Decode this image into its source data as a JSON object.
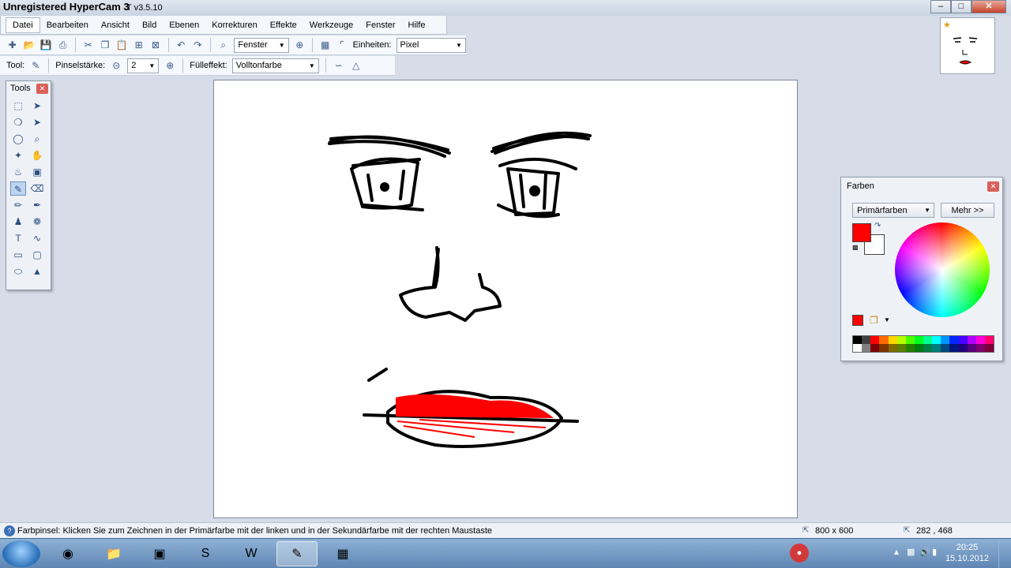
{
  "window": {
    "title": "Unregistered HyperCam 3",
    "version": "T v3.5.10",
    "buttons": [
      "minimize",
      "maximize",
      "close"
    ]
  },
  "menu": {
    "items": [
      "Datei",
      "Bearbeiten",
      "Ansicht",
      "Bild",
      "Ebenen",
      "Korrekturen",
      "Effekte",
      "Werkzeuge",
      "Fenster",
      "Hilfe"
    ]
  },
  "toolbar1": {
    "zoom_mode": "Fenster",
    "units_label": "Einheiten:",
    "units_value": "Pixel"
  },
  "toolbar2": {
    "tool_label": "Tool:",
    "brush_width_label": "Pinselstärke:",
    "brush_width_value": "2",
    "fill_label": "Fülleffekt:",
    "fill_value": "Volltonfarbe"
  },
  "tools_panel": {
    "title": "Tools",
    "tools": [
      "rectangle-select-icon",
      "move-selection-icon",
      "lasso-select-icon",
      "move-pixels-icon",
      "ellipse-select-icon",
      "zoom-icon",
      "magic-wand-icon",
      "pan-hand-icon",
      "paint-bucket-icon",
      "gradient-icon",
      "paintbrush-icon",
      "eraser-icon",
      "pencil-icon",
      "color-picker-icon",
      "clone-stamp-icon",
      "recolor-icon",
      "text-icon",
      "line-curve-icon",
      "rectangle-icon",
      "rounded-rectangle-icon",
      "ellipse-icon",
      "freeform-shape-icon"
    ],
    "active_index": 10
  },
  "colors_panel": {
    "title": "Farben",
    "mode": "Primärfarben",
    "more_button": "Mehr >>",
    "primary_color": "#ff0000",
    "secondary_color": "#ffffff",
    "palette_top": [
      "#000000",
      "#404040",
      "#ff0000",
      "#ff6a00",
      "#ffd800",
      "#b6ff00",
      "#4cff00",
      "#00ff21",
      "#00ff90",
      "#00ffff",
      "#0094ff",
      "#0026ff",
      "#4800ff",
      "#b200ff",
      "#ff00dc",
      "#ff006e"
    ],
    "palette_bottom": [
      "#ffffff",
      "#808080",
      "#7f0000",
      "#7f3300",
      "#7f6a00",
      "#5b7f00",
      "#267f00",
      "#007f0e",
      "#007f46",
      "#007f7f",
      "#004a7f",
      "#00137f",
      "#21007f",
      "#57007f",
      "#7f006e",
      "#7f0037"
    ]
  },
  "statusbar": {
    "hint": "Farbpinsel: Klicken Sie zum Zeichnen in der Primärfarbe mit der linken und in der Sekundärfarbe mit der rechten Maustaste",
    "image_size": "800 x 600",
    "cursor_pos": "282 , 468"
  },
  "taskbar": {
    "apps": [
      "explorer-icon",
      "chrome-icon",
      "file-manager-icon",
      "terminal-icon",
      "skype-icon",
      "wow-icon",
      "paint-net-icon",
      "photo-viewer-icon"
    ],
    "active_app_index": 6,
    "time": "20:25",
    "date": "15.10.2012"
  }
}
